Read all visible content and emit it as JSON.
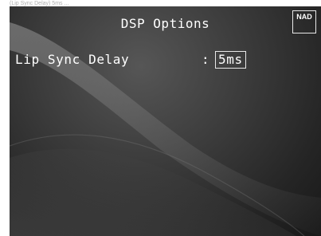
{
  "caption": "(Lip Sync Delay) 5ms ...",
  "screen": {
    "title": "DSP Options",
    "logo": "NAD",
    "setting": {
      "label": "Lip Sync Delay",
      "separator": ":",
      "value": "5ms"
    }
  },
  "colors": {
    "text": "#ffffff",
    "background": "#2e2e2e",
    "border": "#e8e8e8"
  }
}
